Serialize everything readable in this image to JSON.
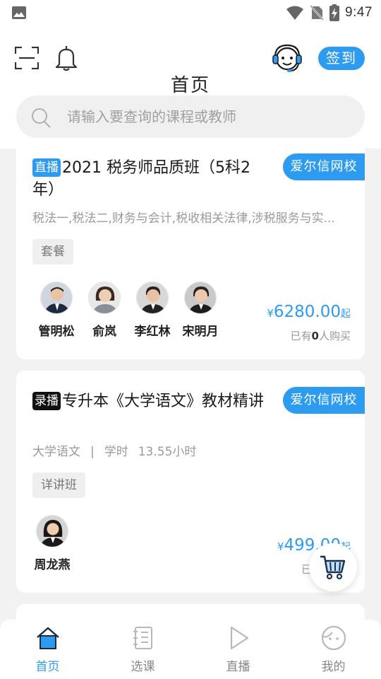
{
  "status": {
    "time": "9:47"
  },
  "header": {
    "title": "首页",
    "checkin_label": "签到"
  },
  "search": {
    "placeholder": "请输入要查询的课程或教师"
  },
  "courses": [
    {
      "tag": "直播",
      "title": "2021 税务师品质班（5科2年）",
      "school": "爱尔信网校",
      "description": "税法一,税法二,财务与会计,税收相关法律,涉税服务与实...",
      "pill": "套餐",
      "teachers": [
        "管明松",
        "俞岚",
        "李红林",
        "宋明月"
      ],
      "price_symbol": "¥",
      "price": "6280.00",
      "price_suffix": "起",
      "buyers_prefix": "已有",
      "buyers_count": "0",
      "buyers_suffix": "人购买"
    },
    {
      "tag": "录播",
      "title": "专升本《大学语文》教材精讲",
      "school": "爱尔信网校",
      "subject": "大学语文",
      "separator": "|",
      "hours_label": "学时",
      "hours_value": "13.55小时",
      "pill": "详讲班",
      "teachers": [
        "周龙燕"
      ],
      "price_symbol": "¥",
      "price": "499.00",
      "price_suffix": "起",
      "buyers_prefix": "已有"
    }
  ],
  "nav": [
    {
      "label": "首页",
      "icon": "home-icon",
      "active": true
    },
    {
      "label": "选课",
      "icon": "notebook-icon",
      "active": false
    },
    {
      "label": "直播",
      "icon": "play-icon",
      "active": false
    },
    {
      "label": "我的",
      "icon": "profile-face-icon",
      "active": false
    }
  ],
  "colors": {
    "accent": "#2d9cf0",
    "background": "#f2f2f2"
  }
}
